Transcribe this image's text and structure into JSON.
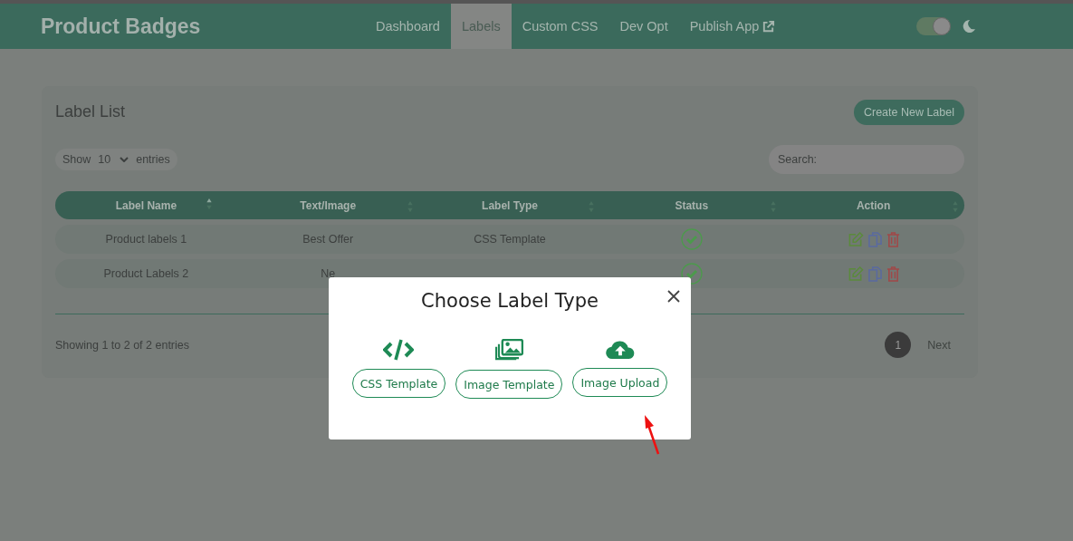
{
  "app": {
    "title": "Product Badges"
  },
  "nav": [
    {
      "label": "Dashboard",
      "selected": false,
      "external": false
    },
    {
      "label": "Labels",
      "selected": true,
      "external": false
    },
    {
      "label": "Custom CSS",
      "selected": false,
      "external": false
    },
    {
      "label": "Dev Opt",
      "selected": false,
      "external": false
    },
    {
      "label": "Publish App",
      "selected": false,
      "external": true
    }
  ],
  "theme_toggle": {
    "on": true
  },
  "card": {
    "title": "Label List",
    "create_button": "Create New Label",
    "length": {
      "prefix": "Show",
      "value": "10",
      "suffix": "entries"
    },
    "search": {
      "placeholder": "Search:"
    }
  },
  "table": {
    "columns": [
      {
        "label": "Label Name",
        "sorted": true
      },
      {
        "label": "Text/Image",
        "sorted": false
      },
      {
        "label": "Label Type",
        "sorted": false
      },
      {
        "label": "Status",
        "sorted": false
      },
      {
        "label": "Action",
        "sorted": false
      }
    ],
    "rows": [
      {
        "label_name": "Product labels 1",
        "text_image": "Best Offer",
        "label_type": "CSS Template",
        "active": true
      },
      {
        "label_name": "Product Labels 2",
        "text_image": "Ne",
        "active": true
      }
    ]
  },
  "footer": {
    "info": "Showing 1 to 2 of 2 entries",
    "pages": [
      {
        "label": "1",
        "selected": true
      }
    ],
    "next": "Next"
  },
  "modal": {
    "title": "Choose Label Type",
    "options": [
      {
        "kind": "code",
        "label": "CSS Template"
      },
      {
        "kind": "images",
        "label": "Image Template"
      },
      {
        "kind": "upload",
        "label": "Image Upload"
      }
    ]
  }
}
